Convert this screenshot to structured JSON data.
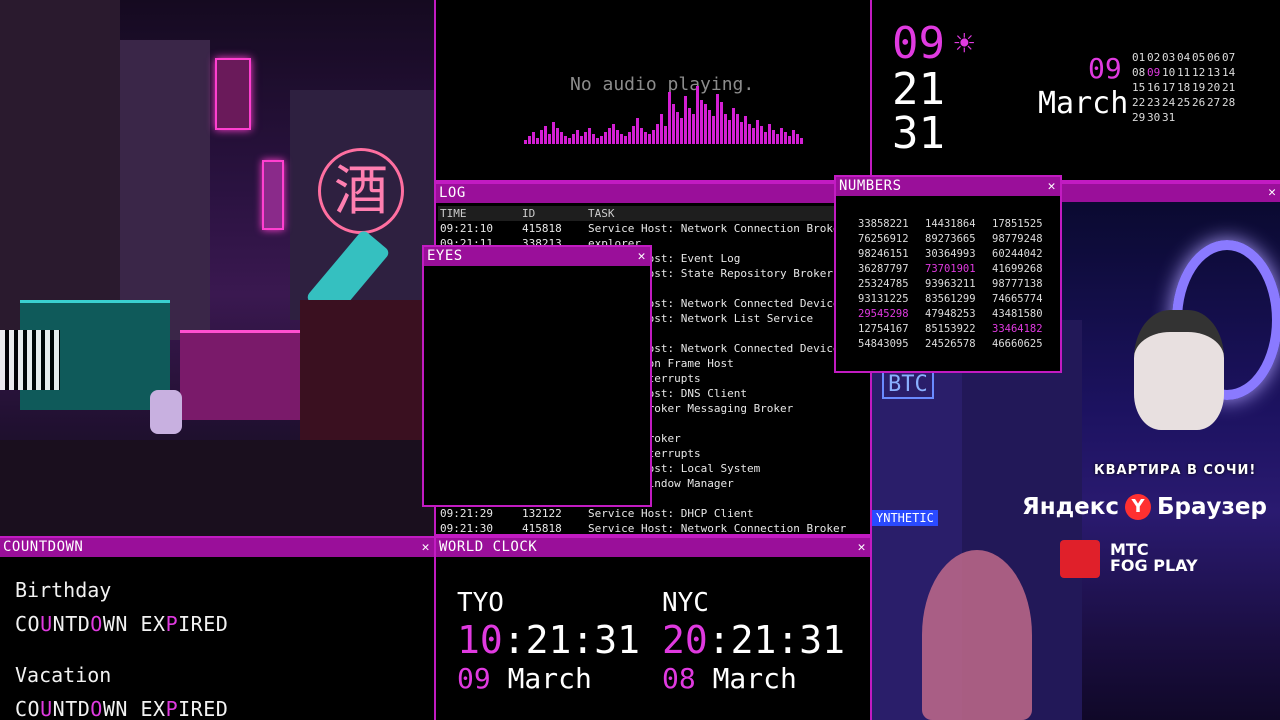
{
  "colors": {
    "accent": "#c21bc2",
    "highlight": "#e03ae0",
    "titlebar": "#9a0f9a"
  },
  "audio": {
    "message": "No audio playing."
  },
  "date_widget": {
    "day": "09",
    "hour": "21",
    "minute": "31",
    "weather_icon": "sun-icon",
    "cal_day": "09",
    "month": "March",
    "calendar_rows": [
      [
        "01",
        "02",
        "03",
        "04",
        "05",
        "06",
        "07"
      ],
      [
        "08",
        "09",
        "10",
        "11",
        "12",
        "13",
        "14"
      ],
      [
        "15",
        "16",
        "17",
        "18",
        "19",
        "20",
        "21"
      ],
      [
        "22",
        "23",
        "24",
        "25",
        "26",
        "27",
        "28"
      ],
      [
        "29",
        "30",
        "31"
      ]
    ],
    "highlighted_date": "09"
  },
  "log": {
    "title": "LOG",
    "columns": [
      "TIME",
      "ID",
      "TASK"
    ],
    "rows": [
      [
        "09:21:10",
        "415818",
        "Service Host: Network Connection Broker"
      ],
      [
        "09:21:11",
        "338213",
        "explorer"
      ],
      [
        "",
        "",
        "Service Host: Event Log"
      ],
      [
        "",
        "",
        "Service Host: State Repository Broker"
      ],
      [
        "",
        "",
        ""
      ],
      [
        "",
        "",
        "Service Host: Network Connected Devices"
      ],
      [
        "",
        "",
        "Service Host: Network List Service"
      ],
      [
        "",
        "",
        ""
      ],
      [
        "",
        "",
        "Service Host: Network Connected Devices"
      ],
      [
        "",
        "",
        "Application Frame Host"
      ],
      [
        "",
        "",
        "System interrupts"
      ],
      [
        "",
        "",
        "Service Host: DNS Client"
      ],
      [
        "",
        "",
        "Runtime Broker Messaging Broker"
      ],
      [
        "",
        "",
        ""
      ],
      [
        "",
        "",
        "Runtime Broker"
      ],
      [
        "",
        "",
        "System interrupts"
      ],
      [
        "",
        "",
        "Service Host: Local System"
      ],
      [
        "",
        "",
        "Desktop Window Manager"
      ],
      [
        "",
        "",
        ""
      ],
      [
        "09:21:29",
        "132122",
        "Service Host: DHCP Client"
      ],
      [
        "09:21:30",
        "415818",
        "Service Host: Network Connection Broker"
      ]
    ]
  },
  "eyes": {
    "title": "EYES"
  },
  "numbers": {
    "title": "NUMBERS",
    "rows": [
      [
        "33858221",
        "14431864",
        "17851525"
      ],
      [
        "76256912",
        "89273665",
        "98779248"
      ],
      [
        "98246151",
        "30364993",
        "60244042"
      ],
      [
        "36287797",
        "73701901",
        "41699268"
      ],
      [
        "25324785",
        "93963211",
        "98777138"
      ],
      [
        "93131225",
        "83561299",
        "74665774"
      ],
      [
        "29545298",
        "47948253",
        "43481580"
      ],
      [
        "12754167",
        "85153922",
        "33464182"
      ],
      [
        "54843095",
        "24526578",
        "46660625"
      ]
    ]
  },
  "countdown": {
    "title": "COUNTDOWN",
    "items": [
      {
        "name": "Birthday",
        "status": "COUNTDOWN EXPIRED"
      },
      {
        "name": "Vacation",
        "status": "COUNTDOWN EXPIRED"
      }
    ]
  },
  "world_clock": {
    "title": "WORLD CLOCK",
    "cities": [
      {
        "code": "TYO",
        "hour": "10",
        "rest": ":21:31",
        "day": "09",
        "month": "March"
      },
      {
        "code": "NYC",
        "hour": "20",
        "rest": ":21:31",
        "day": "08",
        "month": "March"
      }
    ]
  },
  "scene_left": {
    "sign_char": "酒"
  },
  "overlays": {
    "apartment_ad": "КВАРТИРА В СОЧИ!",
    "yandex": "Яндекс",
    "browser": "Браузер",
    "mts_line1": "МТС",
    "mts_line2": "FOG PLAY",
    "sign_btc": "BTC",
    "sign_synthetic": "YNTHETIC"
  }
}
